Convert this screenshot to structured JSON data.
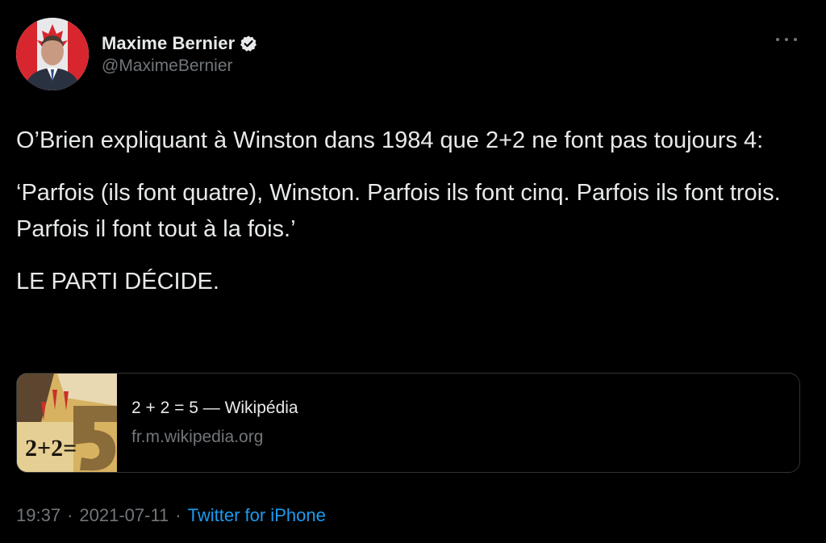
{
  "author": {
    "display_name": "Maxime Bernier",
    "handle": "@MaximeBernier",
    "verified": true,
    "verified_icon": "verified-badge-icon"
  },
  "tweet": {
    "paragraphs": [
      "O’Brien expliquant à Winston dans 1984 que 2+2 ne font pas toujours 4:",
      "‘Parfois (ils font quatre), Winston. Parfois ils font cinq. Parfois ils font trois. Parfois il font tout à la fois.’",
      "LE PARTI DÉCIDE."
    ]
  },
  "card": {
    "title": "2 + 2 = 5 — Wikipédia",
    "domain": "fr.m.wikipedia.org",
    "thumb_text": "2+2="
  },
  "meta": {
    "time": "19:37",
    "date": "2021-07-11",
    "source": "Twitter for iPhone",
    "separator": "·"
  },
  "colors": {
    "background": "#000000",
    "text": "#e7e9ea",
    "secondary": "#71767b",
    "link": "#1d9bf0",
    "border": "#2f3336"
  }
}
